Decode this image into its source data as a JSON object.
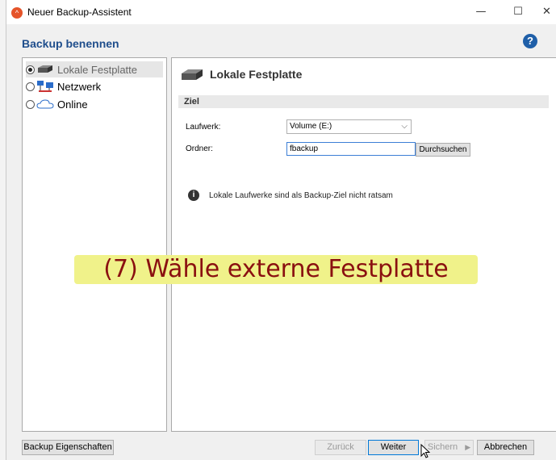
{
  "window": {
    "title": "Neuer Backup-Assistent"
  },
  "heading": "Backup benennen",
  "nav": [
    {
      "label": "Lokale Festplatte",
      "selected": true
    },
    {
      "label": "Netzwerk",
      "selected": false
    },
    {
      "label": "Online",
      "selected": false
    }
  ],
  "panel": {
    "title": "Lokale Festplatte",
    "section": "Ziel",
    "drive_label": "Laufwerk:",
    "drive_value": "Volume (E:)",
    "folder_label": "Ordner:",
    "folder_value": "fbackup",
    "browse_label": "Durchsuchen",
    "info": "Lokale Laufwerke sind als Backup-Ziel nicht ratsam"
  },
  "overlay": "(7) Wähle externe Festplatte",
  "footer": {
    "properties": "Backup Eigenschaften",
    "back": "Zurück",
    "next": "Weiter",
    "save": "Sichern",
    "cancel": "Abbrechen"
  },
  "colors": {
    "heading": "#1f4e8c",
    "overlay_bg": "#f0f28a",
    "overlay_text": "#8a1010",
    "app_icon": "#e5542a"
  }
}
